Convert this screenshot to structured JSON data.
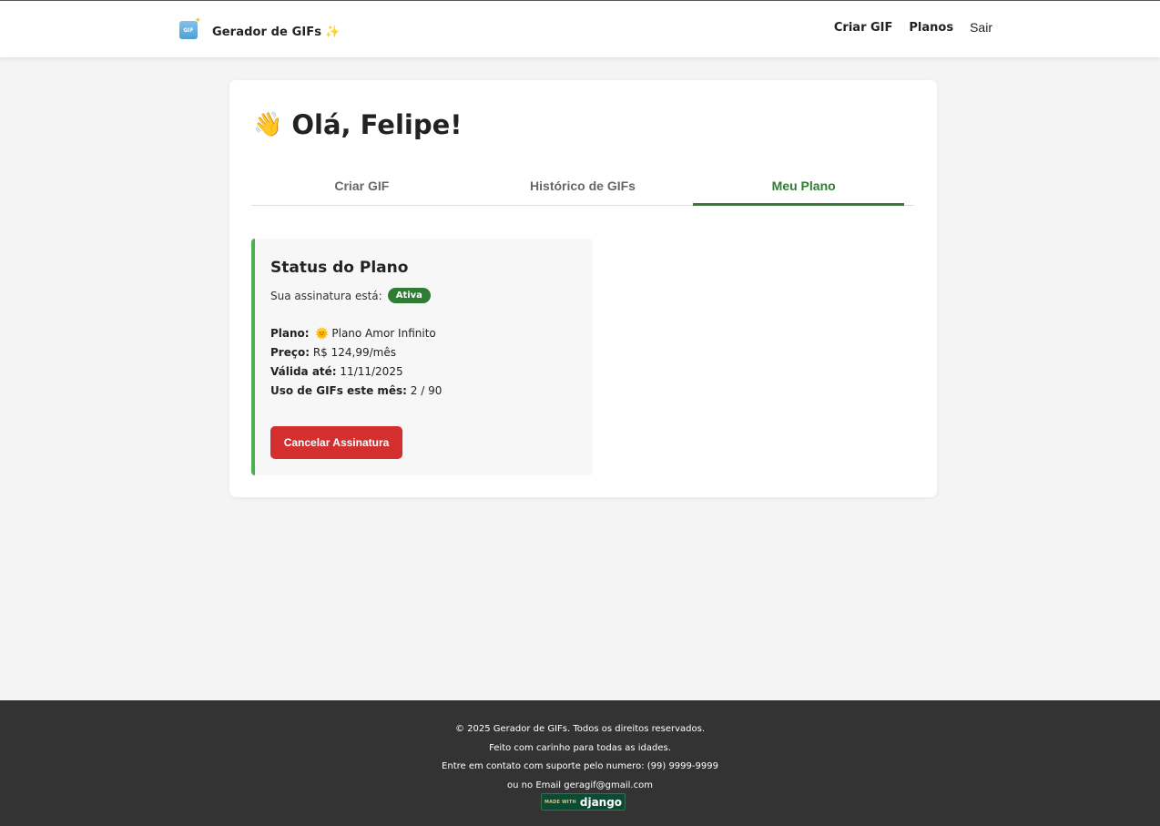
{
  "header": {
    "brand_icon_text": "GIF",
    "brand_name": "Gerador de GIFs",
    "brand_emoji": "✨",
    "nav": {
      "create_gif": "Criar GIF",
      "plans": "Planos",
      "logout": "Sair"
    }
  },
  "main": {
    "greeting_emoji": "👋",
    "greeting": "Olá, Felipe!",
    "tabs": [
      {
        "label": "Criar GIF",
        "active": false
      },
      {
        "label": "Histórico de GIFs",
        "active": false
      },
      {
        "label": "Meu Plano",
        "active": true
      }
    ],
    "plan": {
      "title": "Status do Plano",
      "status_label": "Sua assinatura está:",
      "status_value": "Ativa",
      "plan_label": "Plano:",
      "plan_emoji": "🌞",
      "plan_value": "Plano Amor Infinito",
      "price_label": "Preço:",
      "price_value": "R$ 124,99/mês",
      "valid_label": "Válida até:",
      "valid_value": "11/11/2025",
      "usage_label": "Uso de GIFs este mês:",
      "usage_value": "2 / 90",
      "cancel_button": "Cancelar Assinatura"
    }
  },
  "footer": {
    "line1": "© 2025 Gerador de GIFs. Todos os direitos reservados.",
    "line2": "Feito com carinho para todas as idades.",
    "line3": "Entre em contato com suporte pelo numero: (99) 9999-9999",
    "line4": "ou no Email geragif@gmail.com",
    "badge_small": "MADE WITH",
    "badge_big": "django"
  },
  "colors": {
    "accent_green": "#2e7d32",
    "danger_red": "#d32f2f",
    "footer_bg": "#333333",
    "page_bg": "#f4f4f4"
  }
}
